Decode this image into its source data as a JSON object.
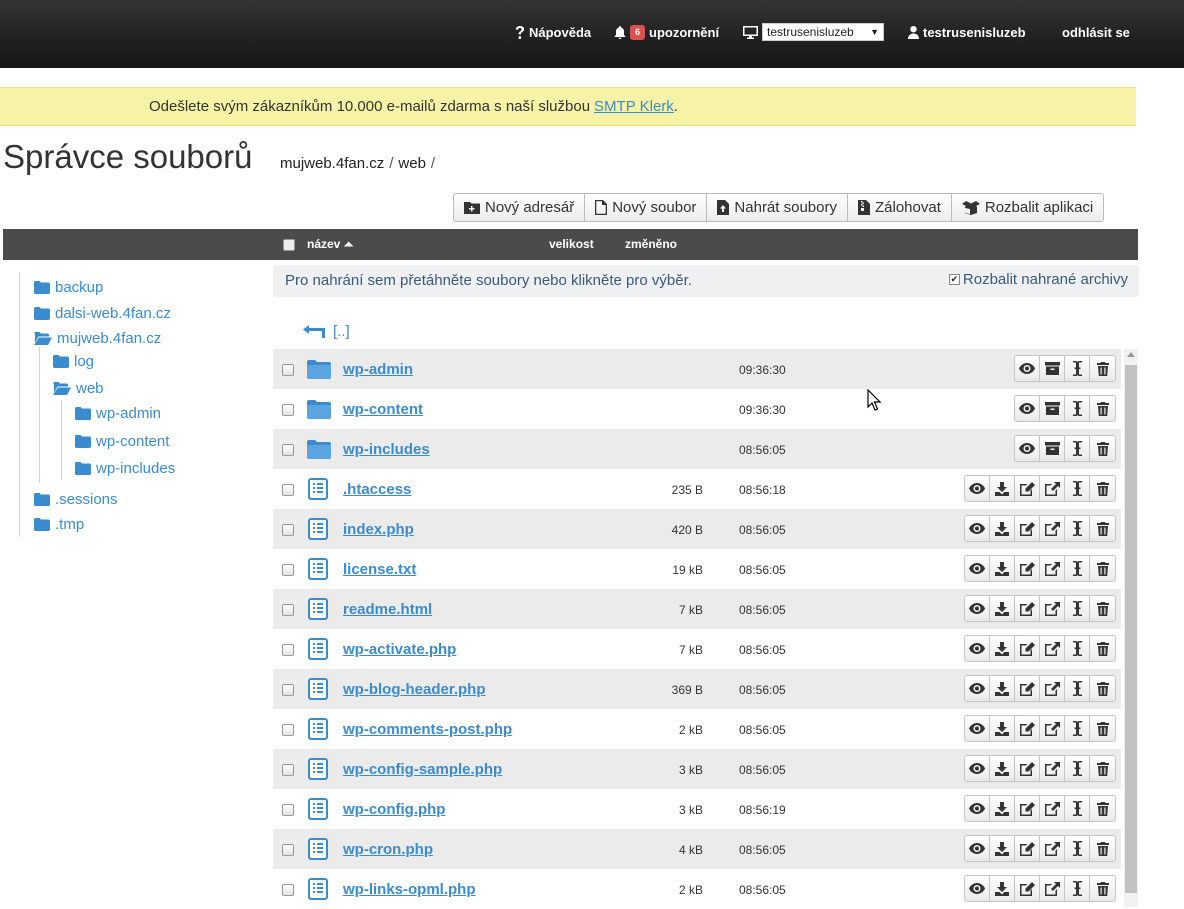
{
  "topbar": {
    "help_label": "Nápověda",
    "notifications_count": "6",
    "notifications_label": "upozornění",
    "server_selected": "testrusenisluzeb",
    "user_label": "testrusenisluzeb",
    "logout_label": "odhlásit se"
  },
  "promo": {
    "text": "Odešlete svým zákazníkům 10.000 e-mailů zdarma s naší službou",
    "link_text": "SMTP Klerk",
    "suffix": "."
  },
  "page": {
    "title": "Správce souborů",
    "breadcrumb": [
      "mujweb.4fan.cz",
      "/",
      "web",
      "/"
    ]
  },
  "toolbar": {
    "new_dir": "Nový adresář",
    "new_file": "Nový soubor",
    "upload": "Nahrát soubory",
    "backup": "Zálohovat",
    "unpack_app": "Rozbalit aplikaci"
  },
  "table": {
    "col_name": "název",
    "col_size": "velikost",
    "col_modified": "změněno"
  },
  "tree": {
    "items": [
      {
        "label": "backup",
        "icon": "folder-icon"
      },
      {
        "label": "dalsi-web.4fan.cz",
        "icon": "folder-icon"
      },
      {
        "label": "mujweb.4fan.cz",
        "icon": "folder-open-icon"
      },
      {
        "label": "log",
        "icon": "folder-icon"
      },
      {
        "label": "web",
        "icon": "folder-open-icon"
      },
      {
        "label": "wp-admin",
        "icon": "folder-icon"
      },
      {
        "label": "wp-content",
        "icon": "folder-icon"
      },
      {
        "label": "wp-includes",
        "icon": "folder-icon"
      },
      {
        "label": ".sessions",
        "icon": "folder-icon"
      },
      {
        "label": ".tmp",
        "icon": "folder-icon"
      }
    ]
  },
  "dropzone": {
    "text": "Pro nahrání sem přetáhněte soubory nebo klikněte pro výběr.",
    "unpack_label": "Rozbalit nahrané archivy",
    "unpack_checked": true
  },
  "parent_dir": {
    "label": "[..]"
  },
  "files": [
    {
      "name": "wp-admin",
      "type": "dir",
      "size": "",
      "time": "09:36:30"
    },
    {
      "name": "wp-content",
      "type": "dir",
      "size": "",
      "time": "09:36:30"
    },
    {
      "name": "wp-includes",
      "type": "dir",
      "size": "",
      "time": "08:56:05"
    },
    {
      "name": ".htaccess",
      "type": "file",
      "size": "235 B",
      "time": "08:56:18"
    },
    {
      "name": "index.php",
      "type": "file",
      "size": "420 B",
      "time": "08:56:05"
    },
    {
      "name": "license.txt",
      "type": "file",
      "size": "19 kB",
      "time": "08:56:05"
    },
    {
      "name": "readme.html",
      "type": "file",
      "size": "7 kB",
      "time": "08:56:05"
    },
    {
      "name": "wp-activate.php",
      "type": "file",
      "size": "7 kB",
      "time": "08:56:05"
    },
    {
      "name": "wp-blog-header.php",
      "type": "file",
      "size": "369 B",
      "time": "08:56:05"
    },
    {
      "name": "wp-comments-post.php",
      "type": "file",
      "size": "2 kB",
      "time": "08:56:05"
    },
    {
      "name": "wp-config-sample.php",
      "type": "file",
      "size": "3 kB",
      "time": "08:56:05"
    },
    {
      "name": "wp-config.php",
      "type": "file",
      "size": "3 kB",
      "time": "08:56:19"
    },
    {
      "name": "wp-cron.php",
      "type": "file",
      "size": "4 kB",
      "time": "08:56:05"
    },
    {
      "name": "wp-links-opml.php",
      "type": "file",
      "size": "2 kB",
      "time": "08:56:05"
    }
  ],
  "row_actions": {
    "dir": [
      "eye-icon",
      "archive-icon",
      "rename-icon",
      "trash-icon"
    ],
    "file": [
      "eye-icon",
      "download-icon",
      "edit-icon",
      "external-link-icon",
      "rename-icon",
      "trash-icon"
    ]
  },
  "colors": {
    "link": "#3b8bcf",
    "header_bg": "#4b4b4b",
    "promo_bg": "#f7f3a6",
    "badge": "#d9534f"
  }
}
